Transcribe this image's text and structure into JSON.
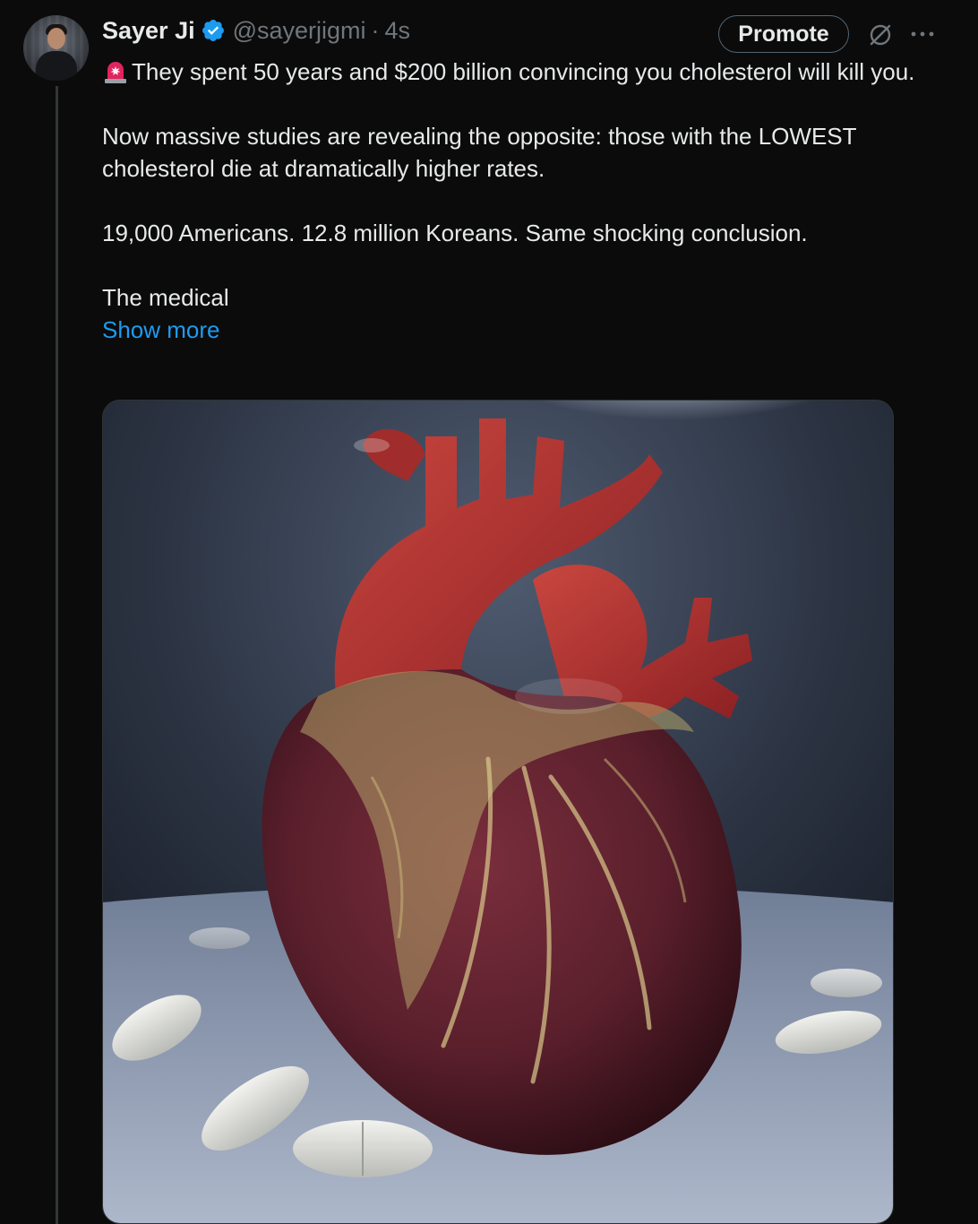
{
  "author": {
    "display_name": "Sayer Ji",
    "handle": "@sayerjigmi",
    "separator": "·",
    "timestamp": "4s",
    "verified": true
  },
  "actions": {
    "promote_label": "Promote"
  },
  "tweet": {
    "line1": "They spent 50 years and $200 billion convincing you cholesterol will kill you.",
    "line2": "Now massive studies are revealing the opposite: those with the LOWEST cholesterol die at dramatically higher rates.",
    "line3": "19,000 Americans. 12.8 million Koreans. Same shocking conclusion.",
    "line4": "The medical",
    "show_more": "Show more"
  },
  "icons": {
    "alarm": "rotating-light-icon",
    "verified": "verified-badge-icon",
    "grok": "grok-icon",
    "more": "more-options-icon"
  },
  "colors": {
    "background": "#0b0b0b",
    "text": "#e7e9ea",
    "muted": "#71767b",
    "link": "#1d9bf0",
    "verified": "#1d9bf0"
  }
}
